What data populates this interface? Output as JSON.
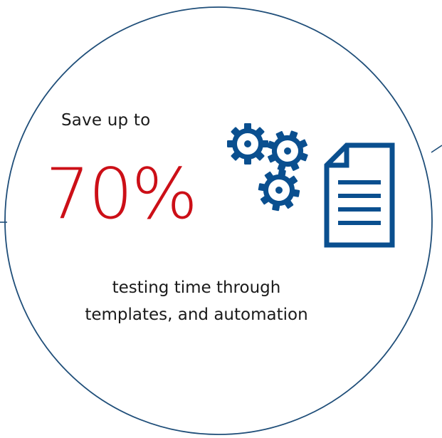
{
  "infographic": {
    "lead_text": "Save up to",
    "headline_value": "70%",
    "caption_line_1": "testing time through",
    "caption_line_2": "templates, and automation"
  },
  "icons": {
    "gears": "gears-icon",
    "document": "document-icon"
  },
  "colors": {
    "accent_red": "#cc0f17",
    "ring_blue": "#1f4e79",
    "icon_blue": "#0a4f8f",
    "text": "#1a1a1a"
  }
}
